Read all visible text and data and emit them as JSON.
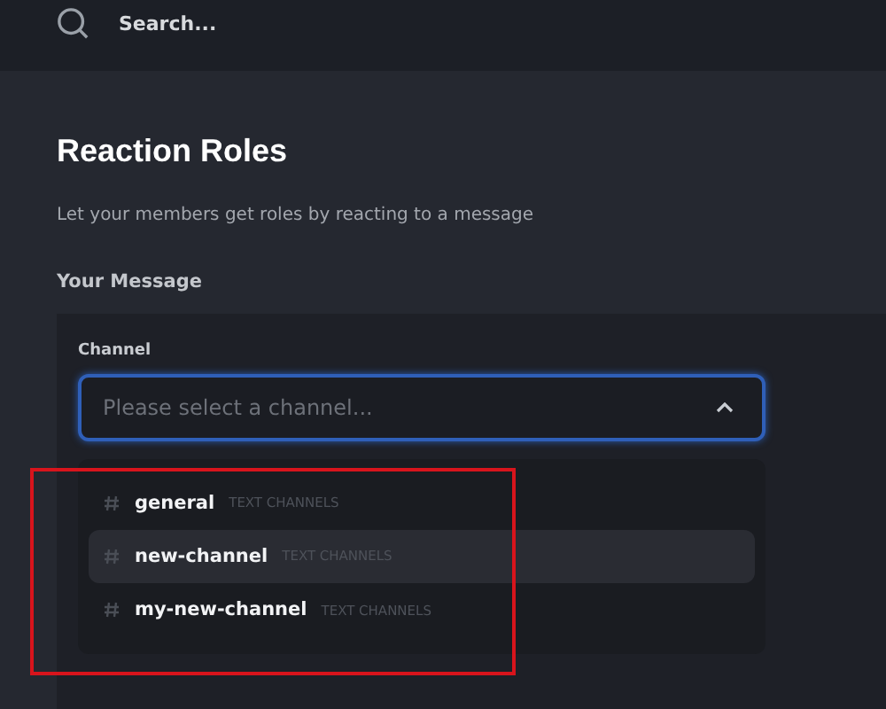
{
  "search": {
    "placeholder": "Search..."
  },
  "page": {
    "title": "Reaction Roles",
    "subtitle": "Let your members get roles by reacting to a message",
    "section": "Your Message"
  },
  "channel_field": {
    "label": "Channel",
    "placeholder": "Please select a channel...",
    "expanded": true
  },
  "options": [
    {
      "name": "general",
      "category": "TEXT CHANNELS",
      "selected": false
    },
    {
      "name": "new-channel",
      "category": "TEXT CHANNELS",
      "selected": true
    },
    {
      "name": "my-new-channel",
      "category": "TEXT CHANNELS",
      "selected": false
    }
  ]
}
